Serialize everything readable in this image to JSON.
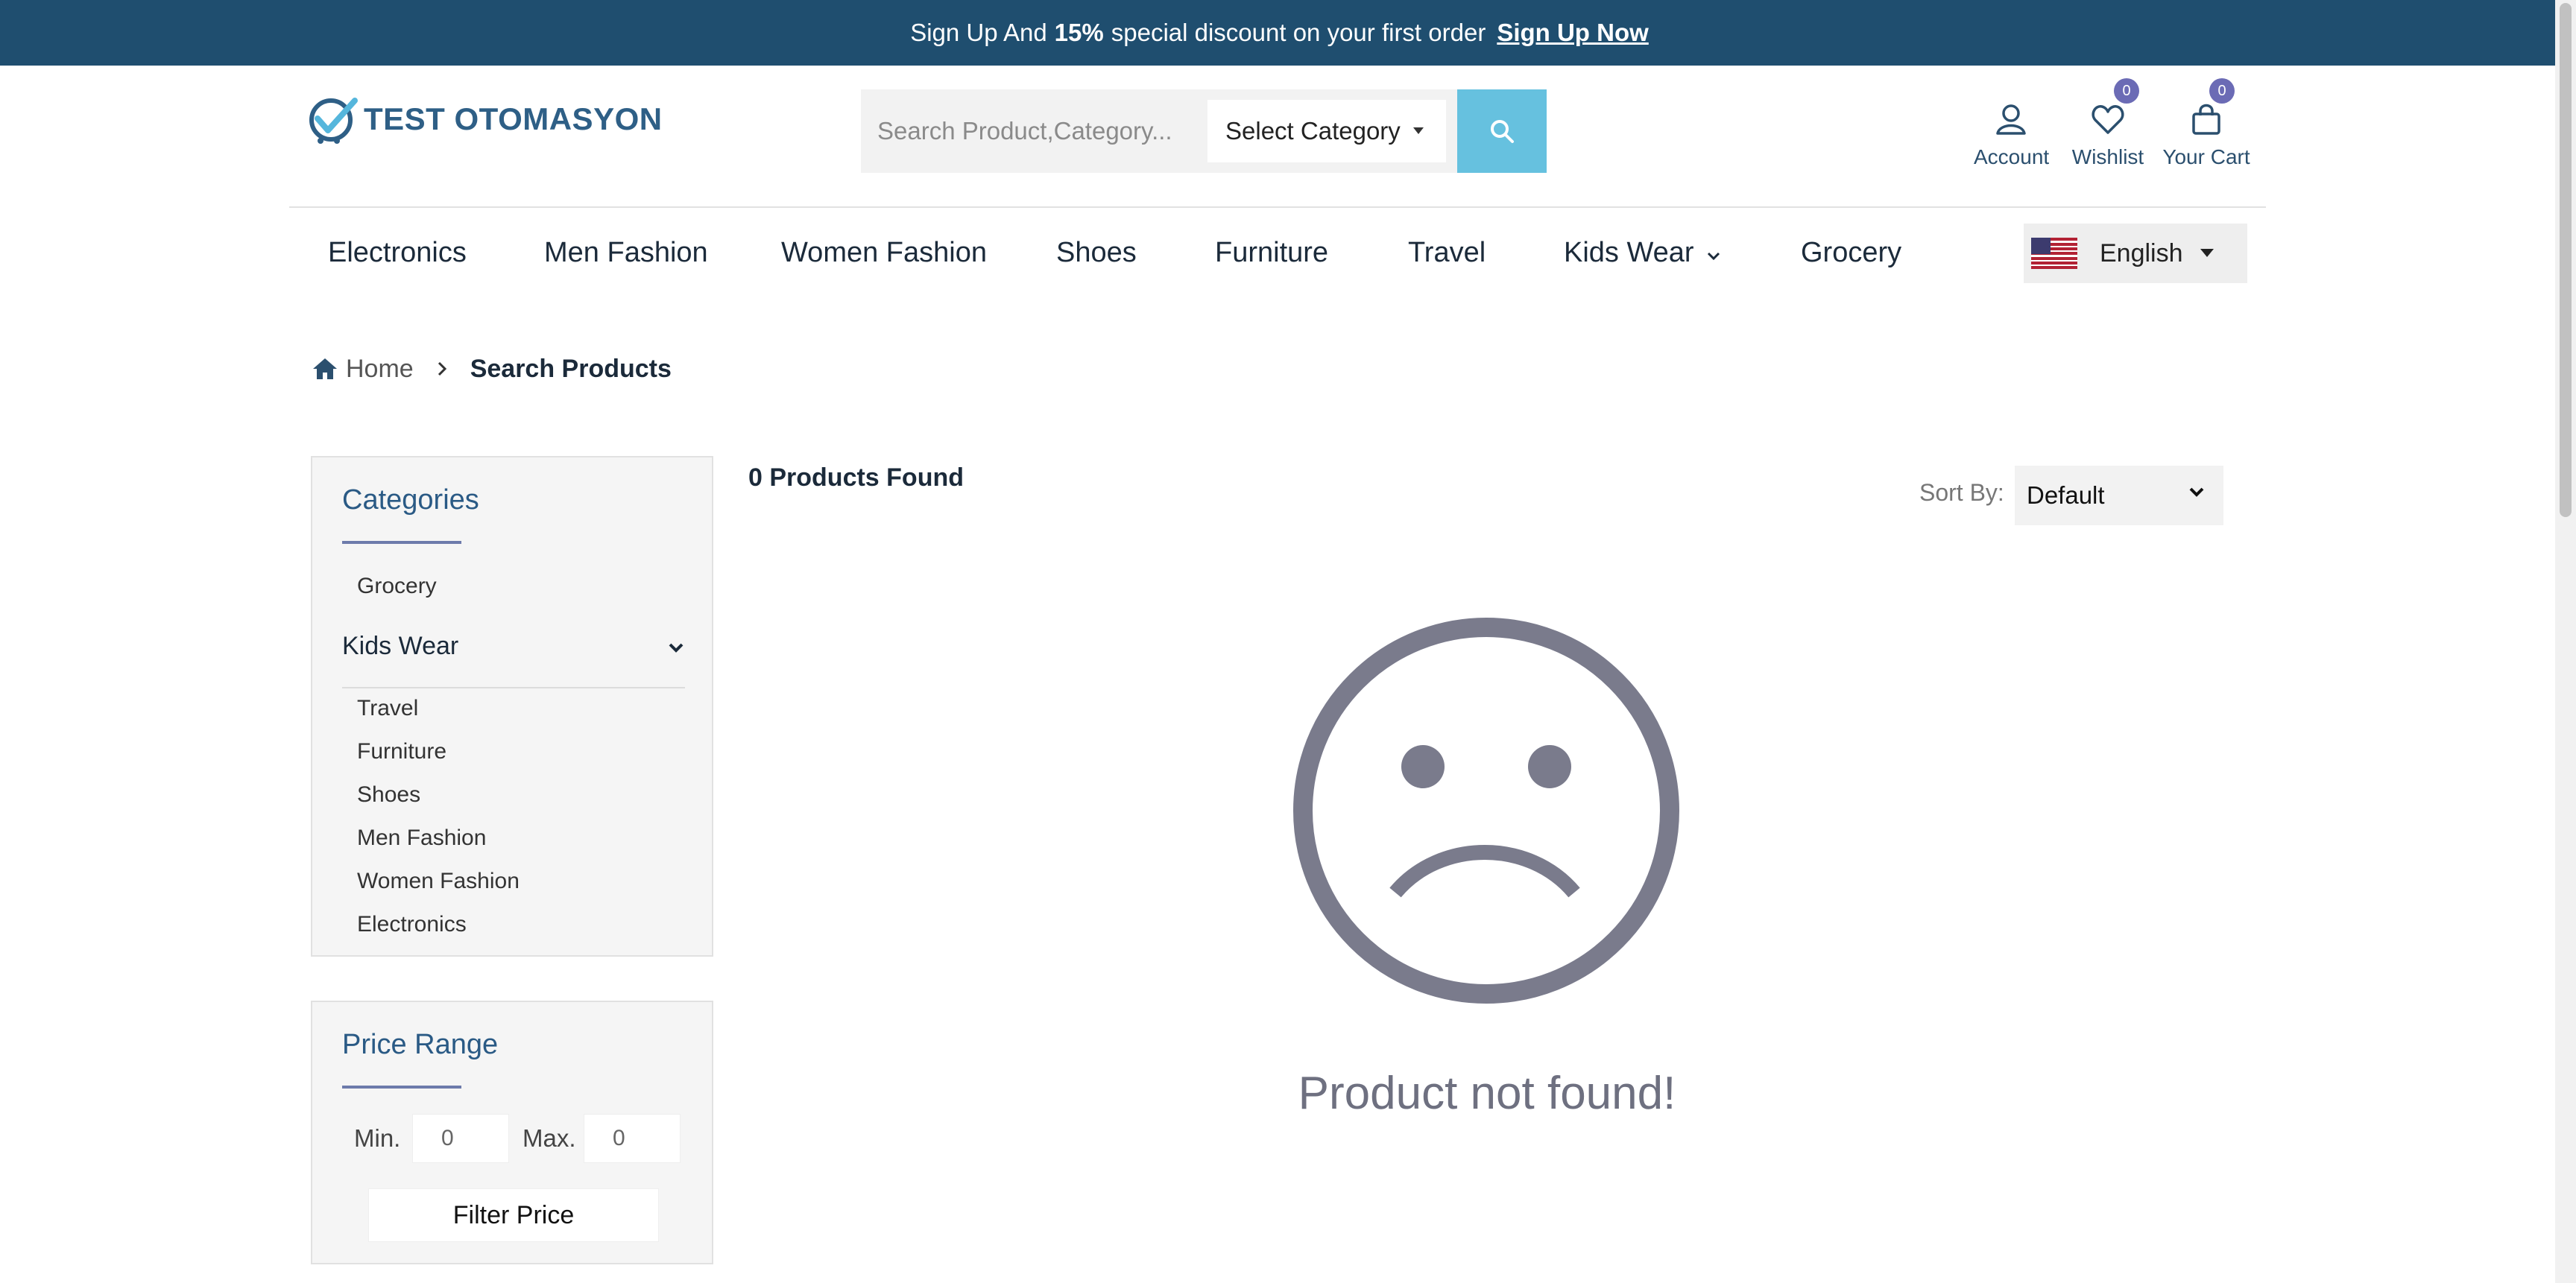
{
  "promo": {
    "text_before": "Sign Up And",
    "discount": "15%",
    "text_after": "special discount on your first order",
    "link": "Sign Up Now"
  },
  "header": {
    "logo_text": "TEST OTOMASYON",
    "search_placeholder": "Search Product,Category...",
    "category_select": "Select Category",
    "account_label": "Account",
    "wishlist_label": "Wishlist",
    "wishlist_count": "0",
    "cart_label": "Your Cart",
    "cart_count": "0"
  },
  "nav": {
    "items": [
      "Electronics",
      "Men Fashion",
      "Women Fashion",
      "Shoes",
      "Furniture",
      "Travel",
      "Kids Wear",
      "Grocery"
    ],
    "language": "English"
  },
  "breadcrumb": {
    "home": "Home",
    "current": "Search Products"
  },
  "sidebar": {
    "categories_title": "Categories",
    "top_item": "Grocery",
    "expanded_parent": "Kids Wear",
    "sub_items": [
      "Travel",
      "Furniture",
      "Shoes",
      "Men Fashion",
      "Women Fashion",
      "Electronics"
    ],
    "price_title": "Price Range",
    "min_label": "Min.",
    "min_value": "0",
    "max_label": "Max.",
    "max_value": "0",
    "filter_button": "Filter Price"
  },
  "main": {
    "found_text": "0 Products Found",
    "sort_label": "Sort By:",
    "sort_value": "Default",
    "empty_message": "Product not found!"
  },
  "colors": {
    "promo_bg": "#1f4e6f",
    "search_btn": "#66c1df",
    "badge": "#6b6bb5",
    "title": "#2a5a85",
    "sad_face": "#7a7b8c"
  }
}
